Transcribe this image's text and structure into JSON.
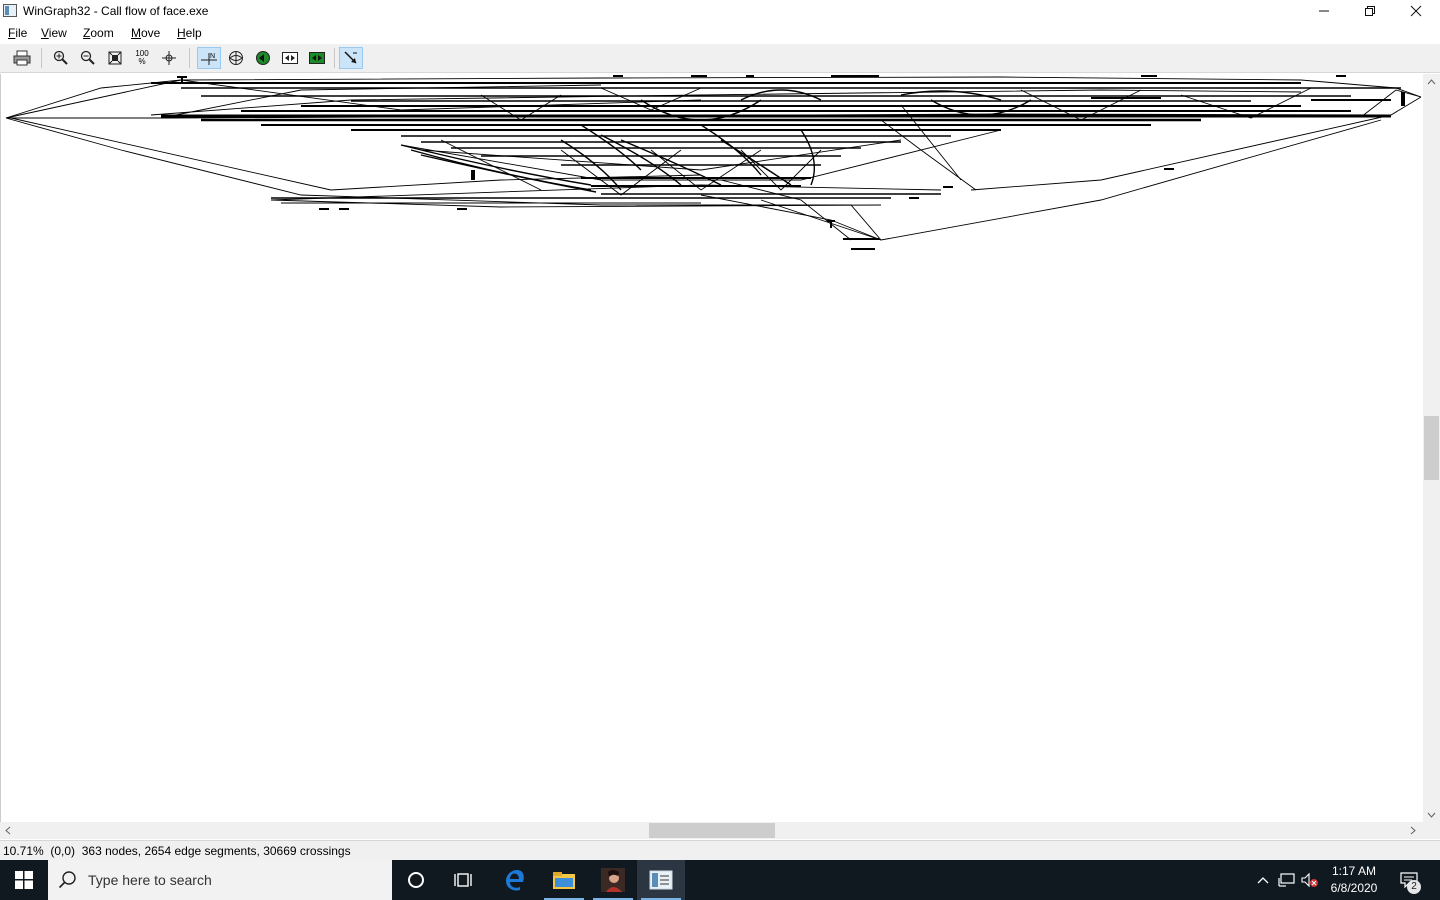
{
  "window": {
    "title": "WinGraph32 - Call flow of face.exe"
  },
  "menu": [
    {
      "accel": "F",
      "rest": "ile"
    },
    {
      "accel": "V",
      "rest": "iew"
    },
    {
      "accel": "Z",
      "rest": "oom"
    },
    {
      "accel": "M",
      "rest": "ove"
    },
    {
      "accel": "H",
      "rest": "elp"
    }
  ],
  "toolbar": {
    "zoom_100_top": "100",
    "zoom_100_bottom": "%"
  },
  "status": {
    "zoom": "10.71%",
    "position": "(0,0)",
    "stats": "363 nodes, 2654 edge segments, 30669 crossings"
  },
  "taskbar": {
    "search_placeholder": "Type here to search",
    "time": "1:17 AM",
    "date": "6/8/2020",
    "notification_count": "2"
  }
}
